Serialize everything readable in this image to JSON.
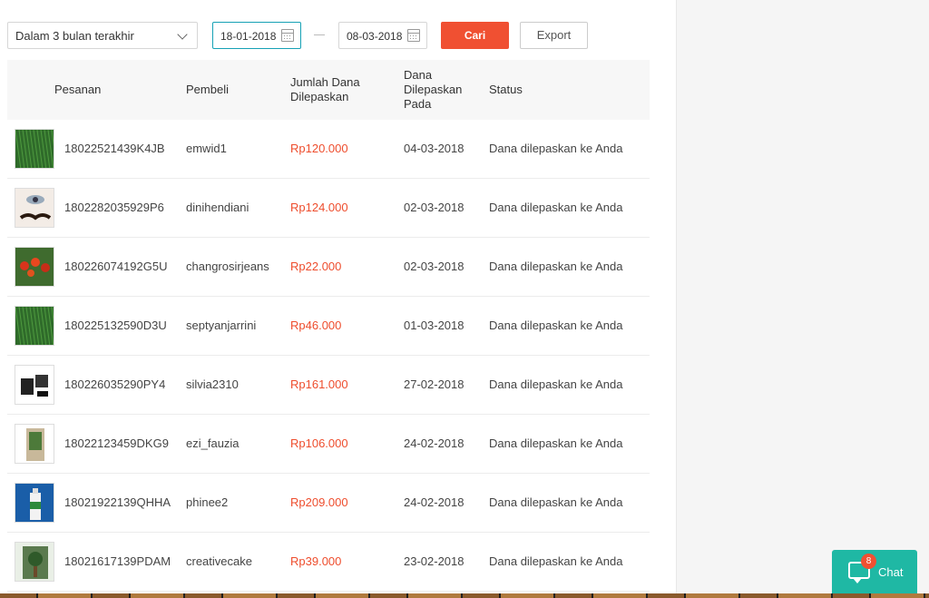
{
  "filters": {
    "period_label": "Dalam 3 bulan terakhir",
    "date_from": "18-01-2018",
    "date_to": "08-03-2018",
    "search_label": "Cari",
    "export_label": "Export"
  },
  "table": {
    "headers": {
      "order": "Pesanan",
      "buyer": "Pembeli",
      "amount": "Jumlah Dana Dilepaskan",
      "released_at": "Dana Dilepaskan Pada",
      "status": "Status"
    },
    "rows": [
      {
        "order": "18022521439K4JB",
        "buyer": "emwid1",
        "amount": "Rp120.000",
        "released_at": "04-03-2018",
        "status": "Dana dilepaskan ke Anda",
        "thumb": "green-grass"
      },
      {
        "order": "1802282035929P6",
        "buyer": "dinihendiani",
        "amount": "Rp124.000",
        "released_at": "02-03-2018",
        "status": "Dana dilepaskan ke Anda",
        "thumb": "eye-lashes"
      },
      {
        "order": "180226074192G5U",
        "buyer": "changrosirjeans",
        "amount": "Rp22.000",
        "released_at": "02-03-2018",
        "status": "Dana dilepaskan ke Anda",
        "thumb": "red-flowers"
      },
      {
        "order": "180225132590D3U",
        "buyer": "septyanjarrini",
        "amount": "Rp46.000",
        "released_at": "01-03-2018",
        "status": "Dana dilepaskan ke Anda",
        "thumb": "green-grass"
      },
      {
        "order": "180226035290PY4",
        "buyer": "silvia2310",
        "amount": "Rp161.000",
        "released_at": "27-02-2018",
        "status": "Dana dilepaskan ke Anda",
        "thumb": "black-objects"
      },
      {
        "order": "18022123459DKG9",
        "buyer": "ezi_fauzia",
        "amount": "Rp106.000",
        "released_at": "24-02-2018",
        "status": "Dana dilepaskan ke Anda",
        "thumb": "plant-pot"
      },
      {
        "order": "18021922139QHHA",
        "buyer": "phinee2",
        "amount": "Rp209.000",
        "released_at": "24-02-2018",
        "status": "Dana dilepaskan ke Anda",
        "thumb": "bottle"
      },
      {
        "order": "18021617139PDAM",
        "buyer": "creativecake",
        "amount": "Rp39.000",
        "released_at": "23-02-2018",
        "status": "Dana dilepaskan ke Anda",
        "thumb": "tree-plant"
      }
    ]
  },
  "chat": {
    "label": "Chat",
    "badge_count": "8"
  }
}
